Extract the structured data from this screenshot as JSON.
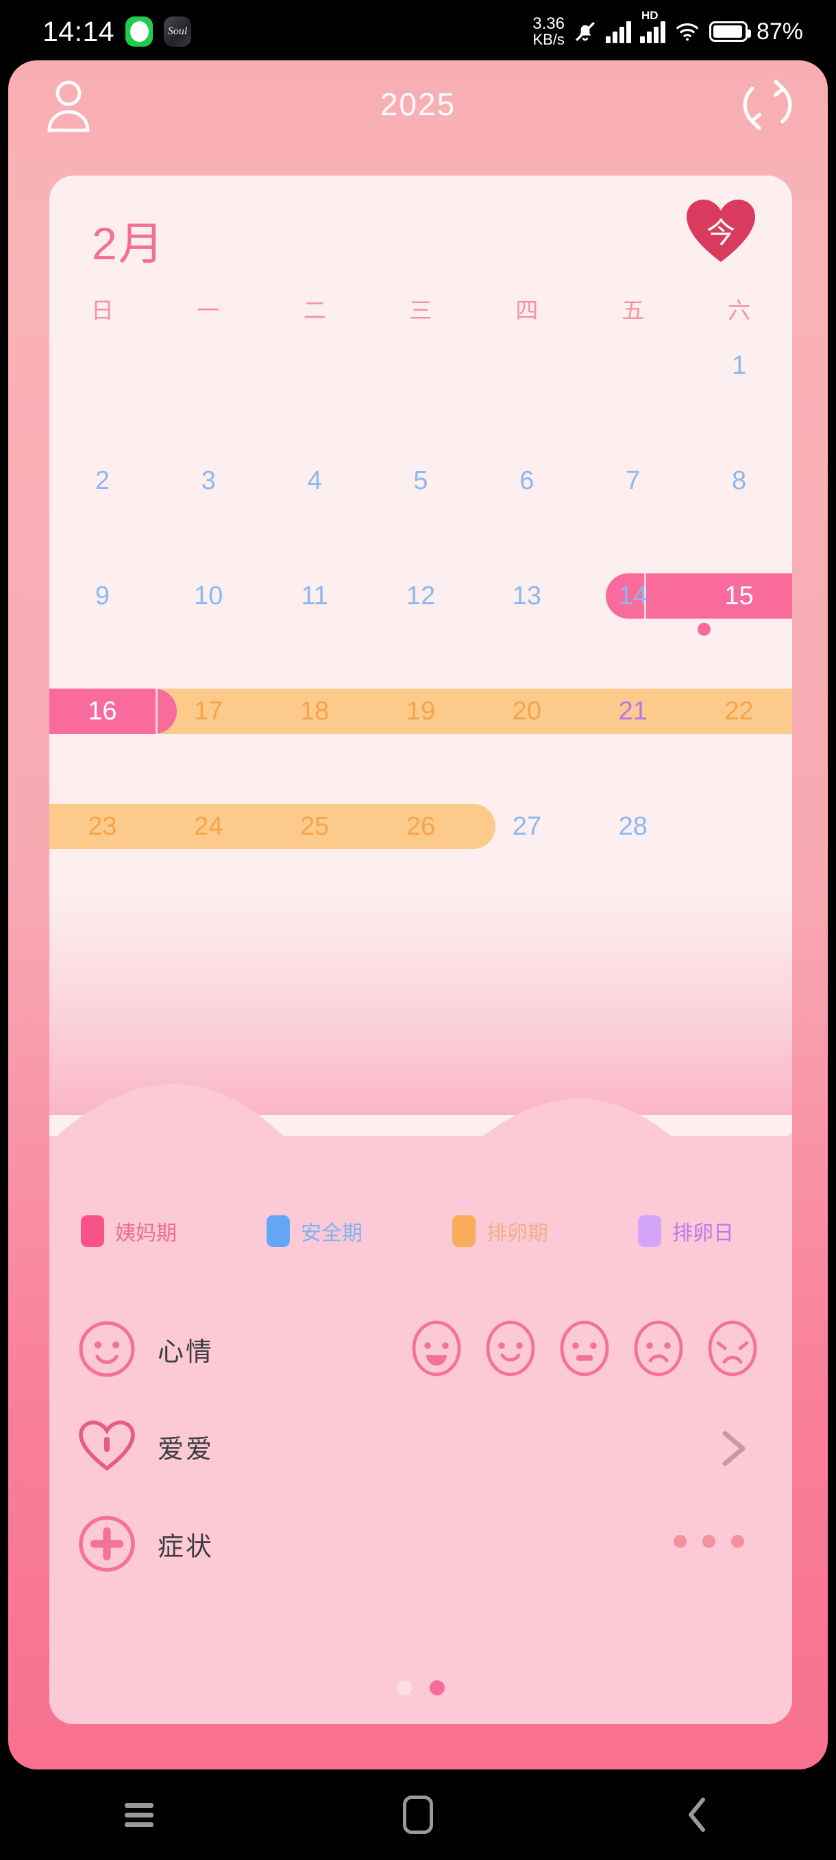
{
  "status_bar": {
    "time": "14:14",
    "app_badge_label": "Soul",
    "network_speed_value": "3.36",
    "network_speed_unit": "KB/s",
    "hd_label": "HD",
    "battery_percent": "87%"
  },
  "header": {
    "title": "2025",
    "profile_icon": "person-icon",
    "sync_icon": "sync-icon"
  },
  "calendar": {
    "month_label": "2月",
    "today_button_label": "今",
    "weekdays": [
      "日",
      "一",
      "二",
      "三",
      "四",
      "五",
      "六"
    ],
    "weeks": [
      [
        {
          "day": "",
          "type": "empty"
        },
        {
          "day": "",
          "type": "empty"
        },
        {
          "day": "",
          "type": "empty"
        },
        {
          "day": "",
          "type": "empty"
        },
        {
          "day": "",
          "type": "empty"
        },
        {
          "day": "",
          "type": "empty"
        },
        {
          "day": "1",
          "type": "safe"
        }
      ],
      [
        {
          "day": "2",
          "type": "safe"
        },
        {
          "day": "3",
          "type": "safe"
        },
        {
          "day": "4",
          "type": "safe"
        },
        {
          "day": "5",
          "type": "safe"
        },
        {
          "day": "6",
          "type": "safe"
        },
        {
          "day": "7",
          "type": "safe"
        },
        {
          "day": "8",
          "type": "safe"
        }
      ],
      [
        {
          "day": "9",
          "type": "safe"
        },
        {
          "day": "10",
          "type": "safe"
        },
        {
          "day": "11",
          "type": "safe"
        },
        {
          "day": "12",
          "type": "safe"
        },
        {
          "day": "13",
          "type": "safe"
        },
        {
          "day": "14",
          "type": "safe"
        },
        {
          "day": "15",
          "type": "period"
        }
      ],
      [
        {
          "day": "16",
          "type": "period"
        },
        {
          "day": "17",
          "type": "ovulation"
        },
        {
          "day": "18",
          "type": "ovulation"
        },
        {
          "day": "19",
          "type": "ovulation"
        },
        {
          "day": "20",
          "type": "ovulation"
        },
        {
          "day": "21",
          "type": "ovulation-day"
        },
        {
          "day": "22",
          "type": "ovulation"
        }
      ],
      [
        {
          "day": "23",
          "type": "ovulation"
        },
        {
          "day": "24",
          "type": "ovulation"
        },
        {
          "day": "25",
          "type": "ovulation"
        },
        {
          "day": "26",
          "type": "ovulation"
        },
        {
          "day": "27",
          "type": "safe"
        },
        {
          "day": "28",
          "type": "safe"
        },
        {
          "day": "",
          "type": "empty"
        }
      ]
    ]
  },
  "legend": [
    {
      "label": "姨妈期",
      "color": "#f85489",
      "text_color": "#f06e94"
    },
    {
      "label": "安全期",
      "color": "#62a6f5",
      "text_color": "#7fb1ef"
    },
    {
      "label": "排卵期",
      "color": "#f9ad5a",
      "text_color": "#f0b08a"
    },
    {
      "label": "排卵日",
      "color": "#d4a5f7",
      "text_color": "#b87ce8"
    }
  ],
  "tracking_rows": [
    {
      "label": "心情",
      "icon": "smiley-face-icon",
      "trailing": "mood-selector"
    },
    {
      "label": "爱爱",
      "icon": "heart-with-bar-icon",
      "trailing": "chevron-right-icon"
    },
    {
      "label": "症状",
      "icon": "plus-circle-icon",
      "trailing": "more-dots-icon"
    }
  ],
  "mood_options": [
    "laughing-face",
    "smiling-face",
    "neutral-face",
    "sad-face",
    "crying-face"
  ],
  "pagination": {
    "total": 2,
    "active_index": 1
  },
  "nav_bar": {
    "recents_icon": "recents-icon",
    "home_icon": "home-icon",
    "back_icon": "back-icon"
  },
  "colors": {
    "period": "#fa6b9d",
    "ovulation": "#fcca8b",
    "safe_text": "#8cb8ef",
    "ovulation_text": "#f7a44a",
    "ovulation_day_text": "#b678ee",
    "accent_pink": "#f4708f"
  }
}
